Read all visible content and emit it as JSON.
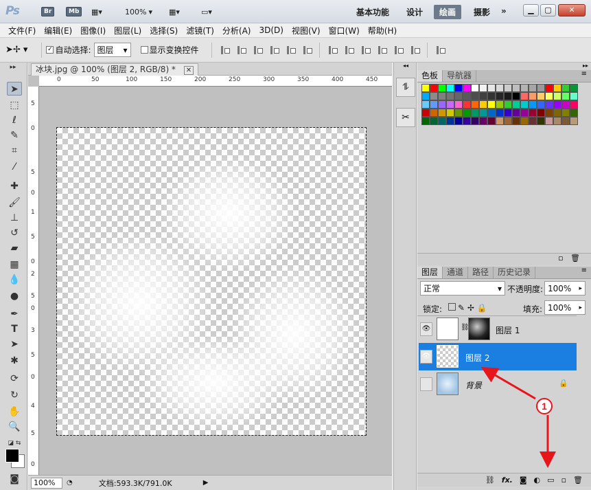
{
  "app": {
    "logo": "Ps",
    "br_badge": "Br",
    "mb_badge": "Mb",
    "zoom_value": "100%",
    "workspaces": [
      "基本功能",
      "设计",
      "绘画",
      "摄影"
    ],
    "active_workspace": "绘画",
    "more_label": "»"
  },
  "menus": [
    "文件(F)",
    "编辑(E)",
    "图像(I)",
    "图层(L)",
    "选择(S)",
    "滤镜(T)",
    "分析(A)",
    "3D(D)",
    "视图(V)",
    "窗口(W)",
    "帮助(H)"
  ],
  "options": {
    "auto_select_label": "自动选择:",
    "auto_select_value": "图层",
    "show_transform_label": "显示变换控件"
  },
  "document": {
    "tab_title": "冰块.jpg @ 100% (图层 2, RGB/8) *",
    "ruler_h": [
      "0",
      "50",
      "100",
      "150",
      "200",
      "250",
      "300",
      "350",
      "400",
      "450"
    ],
    "ruler_v": [
      "5",
      "0",
      "5",
      "0",
      "1",
      "5",
      "0",
      "2",
      "5",
      "0",
      "3",
      "5",
      "0",
      "4",
      "5",
      "0"
    ],
    "zoom": "100%",
    "doc_info": "文档:593.3K/791.0K"
  },
  "swatches_panel": {
    "tabs": [
      "色板",
      "导航器"
    ],
    "colors": [
      "#ffff00",
      "#ff0000",
      "#00ff00",
      "#00ffff",
      "#0000ff",
      "#ff00ff",
      "#ffffff",
      "#f2f2f2",
      "#e6e6e6",
      "#d9d9d9",
      "#cccccc",
      "#bfbfbf",
      "#b3b3b3",
      "#a6a6a6",
      "#999999",
      "#ff0000",
      "#ffcc00",
      "#33cc33",
      "#009933",
      "#00aaff",
      "#8c8c8c",
      "#808080",
      "#737373",
      "#666666",
      "#595959",
      "#4d4d4d",
      "#404040",
      "#333333",
      "#262626",
      "#1a1a1a",
      "#000000",
      "#ff6666",
      "#ff9966",
      "#ffcc66",
      "#ffff66",
      "#ccff66",
      "#66ff66",
      "#66ffcc",
      "#66ccff",
      "#6699ff",
      "#9966ff",
      "#cc66ff",
      "#ff66cc",
      "#ff3333",
      "#ff6600",
      "#ffcc00",
      "#ffff00",
      "#99cc00",
      "#33cc33",
      "#00cc99",
      "#00cccc",
      "#0099ff",
      "#3366ff",
      "#6633ff",
      "#9900ff",
      "#cc00cc",
      "#ff0066",
      "#cc0000",
      "#cc6600",
      "#cc9900",
      "#cccc00",
      "#669900",
      "#009900",
      "#009966",
      "#009999",
      "#0066cc",
      "#0033cc",
      "#3300cc",
      "#660099",
      "#990099",
      "#990033",
      "#800000",
      "#804000",
      "#806600",
      "#808000",
      "#336600",
      "#006600",
      "#006633",
      "#006666",
      "#003399",
      "#000099",
      "#330099",
      "#330066",
      "#660066",
      "#660033",
      "#cc9966",
      "#996633",
      "#663300",
      "#996600",
      "#663333",
      "#333300",
      "#cc9999",
      "#a88a6a",
      "#7a5a3a",
      "#b89a7a"
    ]
  },
  "layers_panel": {
    "tabs": [
      "图层",
      "通道",
      "路径",
      "历史记录"
    ],
    "blend_mode": "正常",
    "opacity_label": "不透明度:",
    "opacity_value": "100%",
    "lock_label": "锁定:",
    "fill_label": "填充:",
    "fill_value": "100%",
    "layers": [
      {
        "name": "图层 1",
        "visible": true,
        "selected": false
      },
      {
        "name": "图层 2",
        "visible": true,
        "selected": true
      },
      {
        "name": "背景",
        "visible": false,
        "selected": false
      }
    ],
    "bottom_icons": [
      "link-icon",
      "fx-icon",
      "mask-icon",
      "adjustment-icon",
      "group-icon",
      "new-layer-icon",
      "trash-icon"
    ],
    "fx_label": "fx."
  },
  "annotation": {
    "marker": "1",
    "color": "#e8151b"
  }
}
